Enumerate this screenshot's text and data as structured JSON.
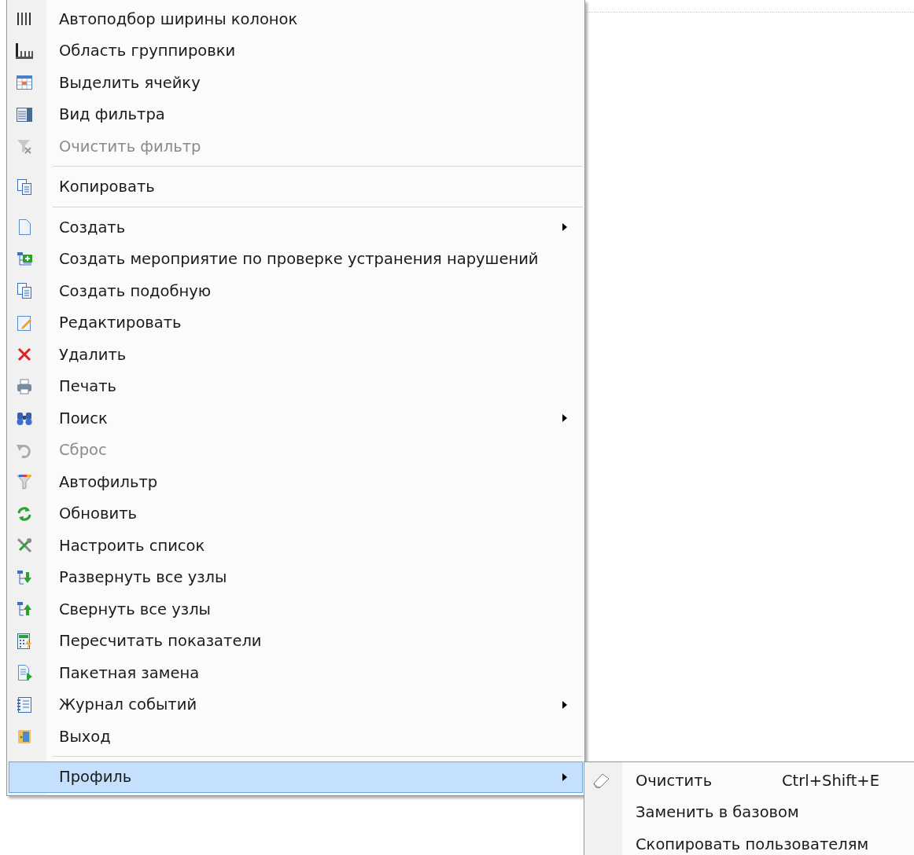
{
  "menu": {
    "items": [
      {
        "kind": "item",
        "label": "Автоподбор ширины колонок",
        "disabled": false,
        "submenu": false,
        "selected": false
      },
      {
        "kind": "item",
        "label": "Область группировки",
        "disabled": false,
        "submenu": false,
        "selected": false
      },
      {
        "kind": "item",
        "label": "Выделить ячейку",
        "disabled": false,
        "submenu": false,
        "selected": false
      },
      {
        "kind": "item",
        "label": "Вид фильтра",
        "disabled": false,
        "submenu": false,
        "selected": false
      },
      {
        "kind": "item",
        "label": "Очистить фильтр",
        "disabled": true,
        "submenu": false,
        "selected": false
      },
      {
        "kind": "separator"
      },
      {
        "kind": "item",
        "label": "Копировать",
        "disabled": false,
        "submenu": false,
        "selected": false
      },
      {
        "kind": "separator"
      },
      {
        "kind": "item",
        "label": "Создать",
        "disabled": false,
        "submenu": true,
        "selected": false
      },
      {
        "kind": "item",
        "label": "Создать мероприятие по проверке устранения нарушений",
        "disabled": false,
        "submenu": false,
        "selected": false
      },
      {
        "kind": "item",
        "label": "Создать подобную",
        "disabled": false,
        "submenu": false,
        "selected": false
      },
      {
        "kind": "item",
        "label": "Редактировать",
        "disabled": false,
        "submenu": false,
        "selected": false
      },
      {
        "kind": "item",
        "label": "Удалить",
        "disabled": false,
        "submenu": false,
        "selected": false
      },
      {
        "kind": "item",
        "label": "Печать",
        "disabled": false,
        "submenu": false,
        "selected": false
      },
      {
        "kind": "item",
        "label": "Поиск",
        "disabled": false,
        "submenu": true,
        "selected": false
      },
      {
        "kind": "item",
        "label": "Сброс",
        "disabled": true,
        "submenu": false,
        "selected": false
      },
      {
        "kind": "item",
        "label": "Автофильтр",
        "disabled": false,
        "submenu": false,
        "selected": false
      },
      {
        "kind": "item",
        "label": "Обновить",
        "disabled": false,
        "submenu": false,
        "selected": false
      },
      {
        "kind": "item",
        "label": "Настроить список",
        "disabled": false,
        "submenu": false,
        "selected": false
      },
      {
        "kind": "item",
        "label": "Развернуть все узлы",
        "disabled": false,
        "submenu": false,
        "selected": false
      },
      {
        "kind": "item",
        "label": "Свернуть все узлы",
        "disabled": false,
        "submenu": false,
        "selected": false
      },
      {
        "kind": "item",
        "label": "Пересчитать показатели",
        "disabled": false,
        "submenu": false,
        "selected": false
      },
      {
        "kind": "item",
        "label": "Пакетная замена",
        "disabled": false,
        "submenu": false,
        "selected": false
      },
      {
        "kind": "item",
        "label": "Журнал событий",
        "disabled": false,
        "submenu": true,
        "selected": false
      },
      {
        "kind": "item",
        "label": "Выход",
        "disabled": false,
        "submenu": false,
        "selected": false
      },
      {
        "kind": "separator"
      },
      {
        "kind": "item",
        "label": "Профиль",
        "disabled": false,
        "submenu": true,
        "selected": true
      }
    ]
  },
  "submenu": {
    "items": [
      {
        "label": "Очистить",
        "shortcut": "Ctrl+Shift+E"
      },
      {
        "label": "Заменить в базовом"
      },
      {
        "label": "Скопировать пользователям"
      }
    ]
  }
}
